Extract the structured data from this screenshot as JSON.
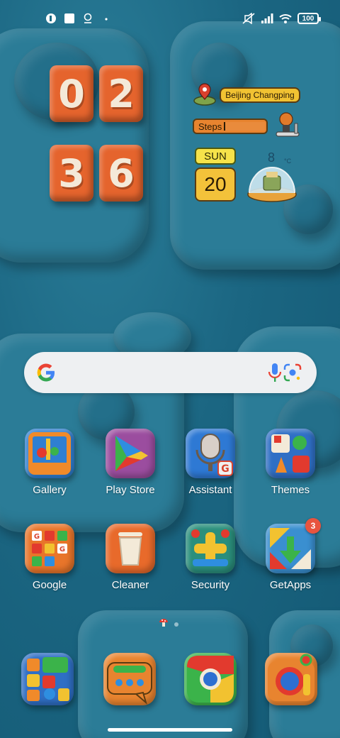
{
  "status_bar": {
    "battery": "100",
    "left_icons": [
      "notification-icon",
      "square-icon",
      "location-icon",
      "dot-icon"
    ],
    "right_icons": [
      "mute-icon",
      "signal-icon",
      "wifi-icon",
      "battery-icon"
    ]
  },
  "clock": {
    "hour_digits": [
      "0",
      "2"
    ],
    "minute_digits": [
      "3",
      "6"
    ]
  },
  "info_widget": {
    "location": "Beijing Changping",
    "steps_label": "Steps",
    "day": "SUN",
    "date": "20",
    "temperature": "8",
    "temperature_unit": "°C"
  },
  "search_bar": {
    "logo": "google-icon",
    "mic": "mic-icon",
    "lens": "lens-icon"
  },
  "apps": [
    {
      "label": "Gallery",
      "icon": "gallery-icon",
      "color": "#2f7fd1"
    },
    {
      "label": "Play Store",
      "icon": "play-store-icon",
      "color": "#9b4d9f"
    },
    {
      "label": "Assistant",
      "icon": "assistant-icon",
      "color": "#2e79d4"
    },
    {
      "label": "Themes",
      "icon": "themes-icon",
      "color": "#2f6fc5"
    },
    {
      "label": "Google",
      "icon": "google-folder-icon",
      "color": "#e8752a"
    },
    {
      "label": "Cleaner",
      "icon": "cleaner-icon",
      "color": "#e86a2b"
    },
    {
      "label": "Security",
      "icon": "security-icon",
      "color": "#2a8f7c"
    },
    {
      "label": "GetApps",
      "icon": "getapps-icon",
      "color": "#3a8fd0",
      "badge": "3"
    }
  ],
  "dock": [
    {
      "icon": "app-library-icon"
    },
    {
      "icon": "messages-icon"
    },
    {
      "icon": "chrome-icon"
    },
    {
      "icon": "camera-icon"
    }
  ]
}
